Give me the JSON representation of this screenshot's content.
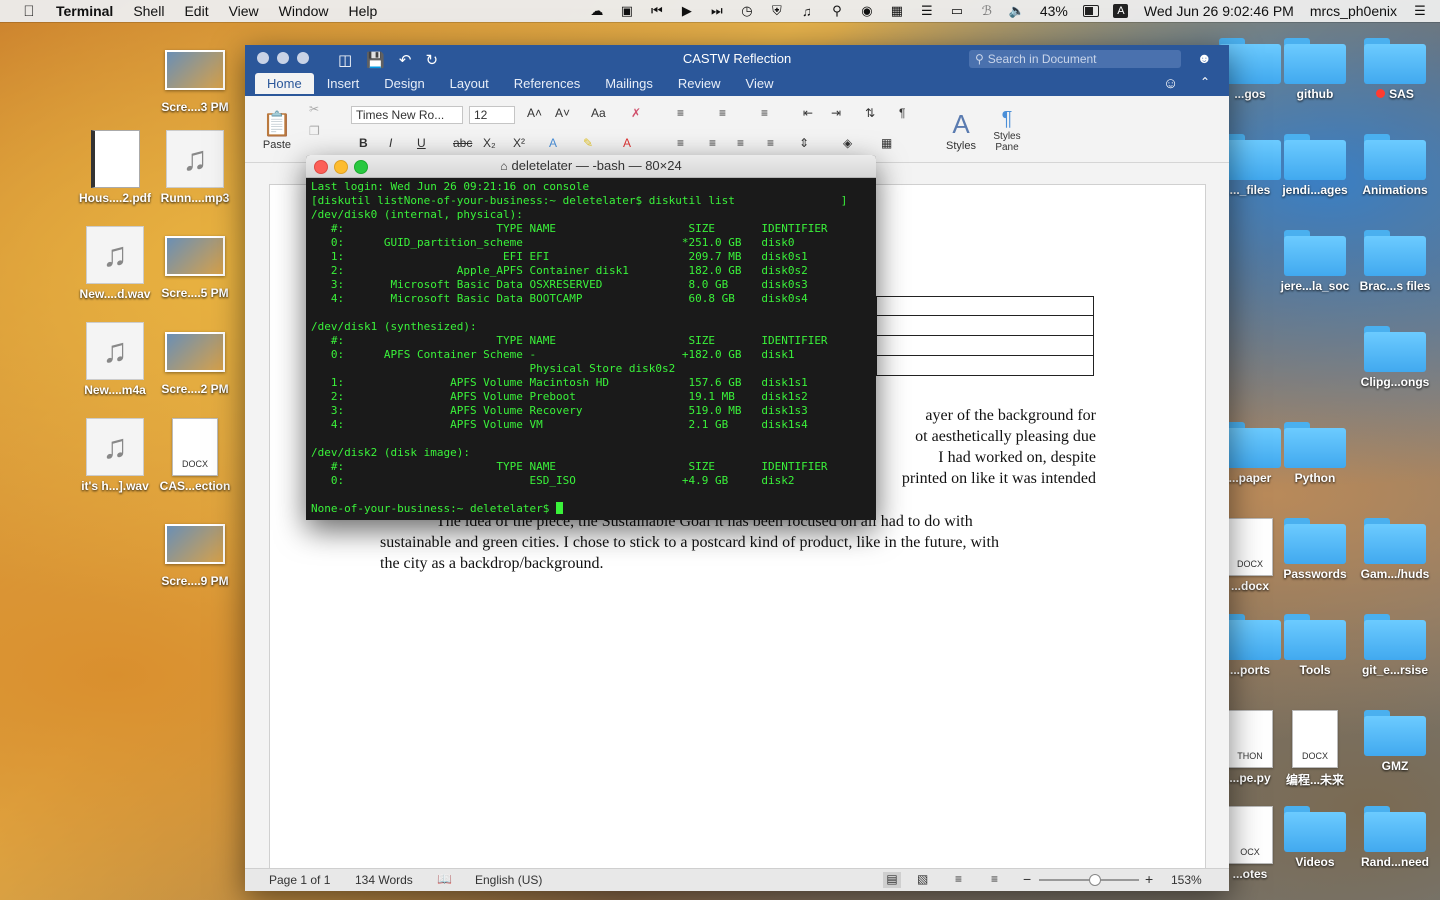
{
  "menubar": {
    "app": "Terminal",
    "items": [
      "Shell",
      "Edit",
      "View",
      "Window",
      "Help"
    ],
    "battery": "43%",
    "input_source": "A",
    "clock": "Wed Jun 26  9:02:46 PM",
    "user": "mrcs_ph0enix"
  },
  "desktop_left": [
    {
      "label": "Scre....3 PM",
      "kind": "thumb"
    },
    {
      "label": "Hous....2.pdf",
      "kind": "pdf"
    },
    {
      "label": "Runn....mp3",
      "kind": "music"
    },
    {
      "label": "New....d.wav",
      "kind": "music"
    },
    {
      "label": "Scre....5 PM",
      "kind": "thumb"
    },
    {
      "label": "New....m4a",
      "kind": "music"
    },
    {
      "label": "Scre....2 PM",
      "kind": "thumb"
    },
    {
      "label": "it's h...].wav",
      "kind": "music"
    },
    {
      "label": "CAS...ection",
      "kind": "docx",
      "badge": "DOCX"
    },
    {
      "label": "Scre....9 PM",
      "kind": "thumb"
    }
  ],
  "desktop_right": [
    {
      "label": "...gos",
      "kind": "folder"
    },
    {
      "label": "github",
      "kind": "folder"
    },
    {
      "label": "SAS",
      "kind": "folder",
      "tag": "red"
    },
    {
      "label": "..._files",
      "kind": "folder"
    },
    {
      "label": "jendi...ages",
      "kind": "folder"
    },
    {
      "label": "Animations",
      "kind": "folder"
    },
    {
      "label": "jere...la_soc",
      "kind": "folder"
    },
    {
      "label": "Brac...s files",
      "kind": "folder"
    },
    {
      "label": "Clipg...ongs",
      "kind": "folder"
    },
    {
      "label": "...paper",
      "kind": "folder"
    },
    {
      "label": "Python",
      "kind": "folder"
    },
    {
      "label": "...docx",
      "kind": "docx",
      "badge": "DOCX"
    },
    {
      "label": "Passwords",
      "kind": "folder"
    },
    {
      "label": "Gam.../huds",
      "kind": "folder"
    },
    {
      "label": "...ports",
      "kind": "folder"
    },
    {
      "label": "Tools",
      "kind": "folder"
    },
    {
      "label": "git_e...rsise",
      "kind": "folder"
    },
    {
      "label": "...pe.py",
      "kind": "docx",
      "badge": "THON"
    },
    {
      "label": "编程...未来",
      "kind": "docx",
      "badge": "DOCX"
    },
    {
      "label": "GMZ",
      "kind": "folder"
    },
    {
      "label": "...otes",
      "kind": "docx",
      "badge": "OCX"
    },
    {
      "label": "Videos",
      "kind": "folder"
    },
    {
      "label": "Rand...need",
      "kind": "folder"
    }
  ],
  "word": {
    "title": "CASTW Reflection",
    "search_placeholder": "Search in Document",
    "tabs": [
      "Home",
      "Insert",
      "Design",
      "Layout",
      "References",
      "Mailings",
      "Review",
      "View"
    ],
    "active_tab": "Home",
    "paste_label": "Paste",
    "font_name": "Times New Ro...",
    "font_size": "12",
    "styles_label": "Styles",
    "styles_pane_label": "Styles Pane",
    "doc_lines": [
      "ayer of the background for",
      "ot aesthetically pleasing due",
      "I had worked on, despite",
      "printed on like it was intended"
    ],
    "doc_paragraph2": [
      "The idea of the piece, the Sustainable Goal it has been focused on all had to do with",
      "sustainable and green cities. I chose to stick to a postcard kind of product, like in the future, with",
      "the city as a backdrop/background."
    ],
    "status": {
      "page": "Page 1 of 1",
      "words": "134 Words",
      "language": "English (US)",
      "zoom": "153%",
      "zoom_level": 0.55
    }
  },
  "terminal": {
    "title": "deletelater — -bash — 80×24",
    "lines": [
      "Last login: Wed Jun 26 09:21:16 on console",
      "[diskutil listNone-of-your-business:~ deletelater$ diskutil list                ]",
      "/dev/disk0 (internal, physical):",
      "   #:                       TYPE NAME                    SIZE       IDENTIFIER",
      "   0:      GUID_partition_scheme                        *251.0 GB   disk0",
      "   1:                        EFI EFI                     209.7 MB   disk0s1",
      "   2:                 Apple_APFS Container disk1         182.0 GB   disk0s2",
      "   3:       Microsoft Basic Data OSXRESERVED             8.0 GB     disk0s3",
      "   4:       Microsoft Basic Data BOOTCAMP                60.8 GB    disk0s4",
      "",
      "/dev/disk1 (synthesized):",
      "   #:                       TYPE NAME                    SIZE       IDENTIFIER",
      "   0:      APFS Container Scheme -                      +182.0 GB   disk1",
      "                                 Physical Store disk0s2",
      "   1:                APFS Volume Macintosh HD            157.6 GB   disk1s1",
      "   2:                APFS Volume Preboot                 19.1 MB    disk1s2",
      "   3:                APFS Volume Recovery                519.0 MB   disk1s3",
      "   4:                APFS Volume VM                      2.1 GB     disk1s4",
      "",
      "/dev/disk2 (disk image):",
      "   #:                       TYPE NAME                    SIZE       IDENTIFIER",
      "   0:                            ESD_ISO                +4.9 GB     disk2",
      "",
      "None-of-your-business:~ deletelater$ "
    ]
  }
}
